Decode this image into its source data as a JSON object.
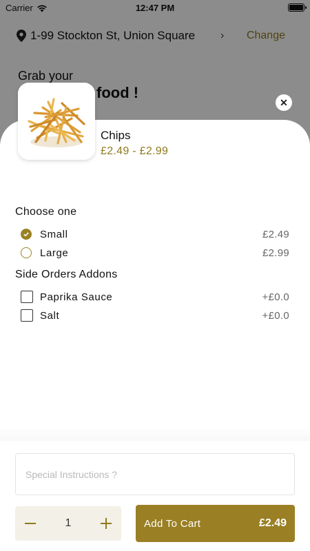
{
  "status_bar": {
    "carrier": "Carrier",
    "time": "12:47 PM"
  },
  "location": {
    "address": "1-99 Stockton St,  Union Square",
    "change_label": "Change"
  },
  "greeting": {
    "line1": "Grab your",
    "line2": "food !"
  },
  "product": {
    "name": "Chips",
    "price_range": "£2.49 - £2.99"
  },
  "size_group": {
    "title": "Choose one",
    "options": [
      {
        "label": "Small",
        "price": "£2.49",
        "selected": true
      },
      {
        "label": "Large",
        "price": "£2.99",
        "selected": false
      }
    ]
  },
  "addons_group": {
    "title": "Side Orders Addons",
    "options": [
      {
        "label": "Paprika Sauce",
        "price": "+£0.0",
        "checked": false
      },
      {
        "label": "Salt",
        "price": "+£0.0",
        "checked": false
      }
    ]
  },
  "instructions": {
    "placeholder": "Special Instructions ?",
    "value": ""
  },
  "quantity": {
    "value": "1"
  },
  "add_to_cart": {
    "label": "Add To Cart",
    "price": "£2.49"
  },
  "colors": {
    "accent": "#9a7f24",
    "accent_text": "#8f7a1c",
    "stepper_bg": "#f3f0e7"
  }
}
